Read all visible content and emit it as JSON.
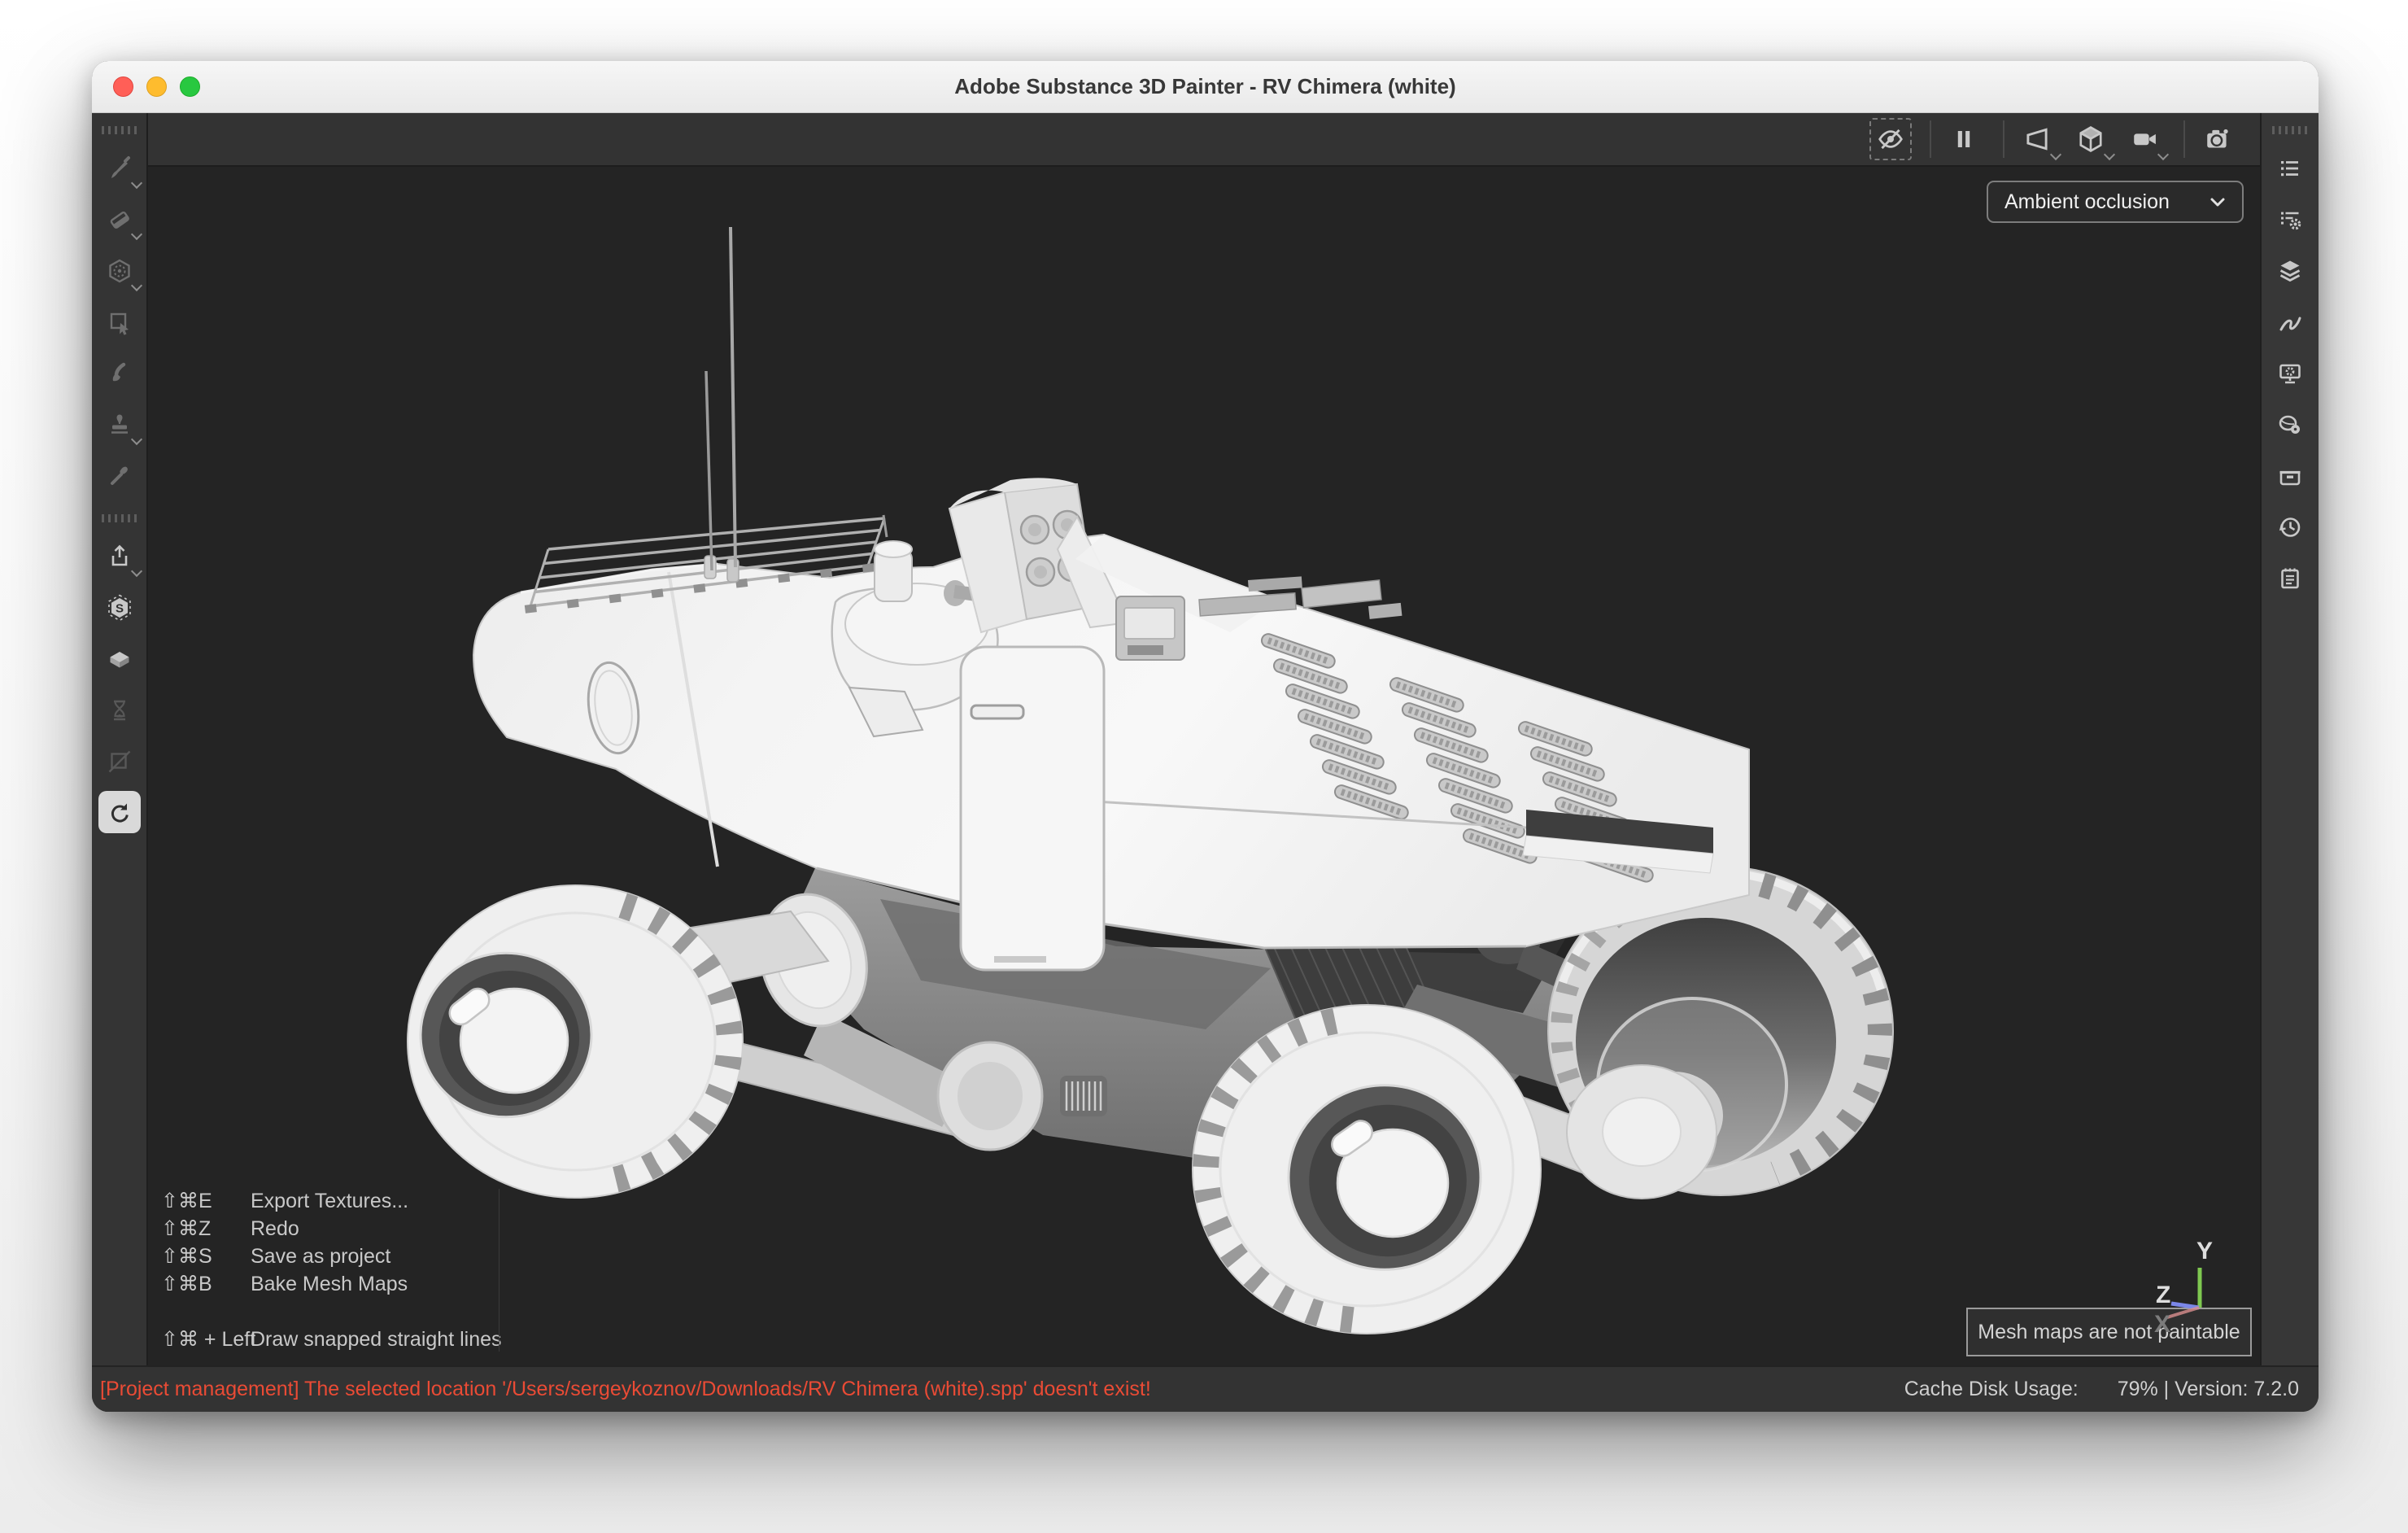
{
  "window": {
    "title": "Adobe Substance 3D Painter - RV Chimera (white)",
    "traffic_lights": [
      "close",
      "minimize",
      "zoom"
    ]
  },
  "viewport": {
    "channel_select": "Ambient occlusion",
    "tooltip": "Mesh maps are not paintable",
    "gizmo": {
      "x": "X",
      "y": "Y",
      "z": "Z"
    }
  },
  "shortcuts": [
    {
      "keys": "⇧⌘E",
      "label": "Export Textures..."
    },
    {
      "keys": "⇧⌘Z",
      "label": "Redo"
    },
    {
      "keys": "⇧⌘S",
      "label": "Save as project"
    },
    {
      "keys": "⇧⌘B",
      "label": "Bake Mesh Maps"
    },
    {
      "keys": "⇧⌘ + Left",
      "label": "Draw snapped straight lines"
    }
  ],
  "statusbar": {
    "error": "[Project management] The selected location '/Users/sergeykoznov/Downloads/RV Chimera (white).spp' doesn't exist!",
    "cache_label": "Cache Disk Usage:",
    "cache_value": "79% | Version: 7.2.0"
  },
  "toolbars": {
    "left_upper": [
      {
        "name": "paint-brush-tool",
        "state": "dim",
        "chevron": true
      },
      {
        "name": "eraser-tool",
        "state": "dim",
        "chevron": true
      },
      {
        "name": "projection-tool",
        "state": "dim",
        "chevron": true
      },
      {
        "name": "polygon-fill-tool",
        "state": "dim",
        "chevron": false
      },
      {
        "name": "smudge-tool",
        "state": "dim",
        "chevron": false
      },
      {
        "name": "clone-stamp-tool",
        "state": "dim",
        "chevron": true
      },
      {
        "name": "color-picker-tool",
        "state": "dim",
        "chevron": false
      }
    ],
    "left_lower": [
      {
        "name": "export-textures",
        "state": "bright",
        "chevron": true
      },
      {
        "name": "substance-source",
        "state": "bright",
        "chevron": false
      },
      {
        "name": "assets",
        "state": "bright",
        "chevron": false
      },
      {
        "name": "bake-disabled",
        "state": "faint",
        "chevron": false
      },
      {
        "name": "uv-disabled",
        "state": "faint",
        "chevron": false
      },
      {
        "name": "resources-updater",
        "state": "selected",
        "chevron": false
      }
    ],
    "right": [
      {
        "name": "properties-panel",
        "state": "bright"
      },
      {
        "name": "settings-list-panel",
        "state": "bright"
      },
      {
        "name": "layers-panel",
        "state": "bright"
      },
      {
        "name": "brush-stroke-panel",
        "state": "bright"
      },
      {
        "name": "display-settings-panel",
        "state": "bright"
      },
      {
        "name": "shader-settings-panel",
        "state": "bright"
      },
      {
        "name": "texture-set-panel",
        "state": "bright"
      },
      {
        "name": "history-panel",
        "state": "bright"
      },
      {
        "name": "log-panel",
        "state": "bright"
      }
    ],
    "viewport_top": [
      {
        "name": "eye-visibility-toggle",
        "boxed": true
      },
      {
        "sep": true
      },
      {
        "name": "pause-engine"
      },
      {
        "sep": true
      },
      {
        "name": "perspective-view",
        "chevron": true
      },
      {
        "name": "mesh-display",
        "chevron": true
      },
      {
        "name": "camera-view",
        "chevron": true
      },
      {
        "sep": true
      },
      {
        "name": "viewport-snapshot"
      }
    ]
  },
  "colors": {
    "error_red": "#ea4b35",
    "axis_y_green": "#7ec850",
    "axis_z_blue": "#7b87e8",
    "axis_x_red": "#d98f8f",
    "selected_tool_bg": "#d9d9d9",
    "viewport_bg": "#242424"
  }
}
